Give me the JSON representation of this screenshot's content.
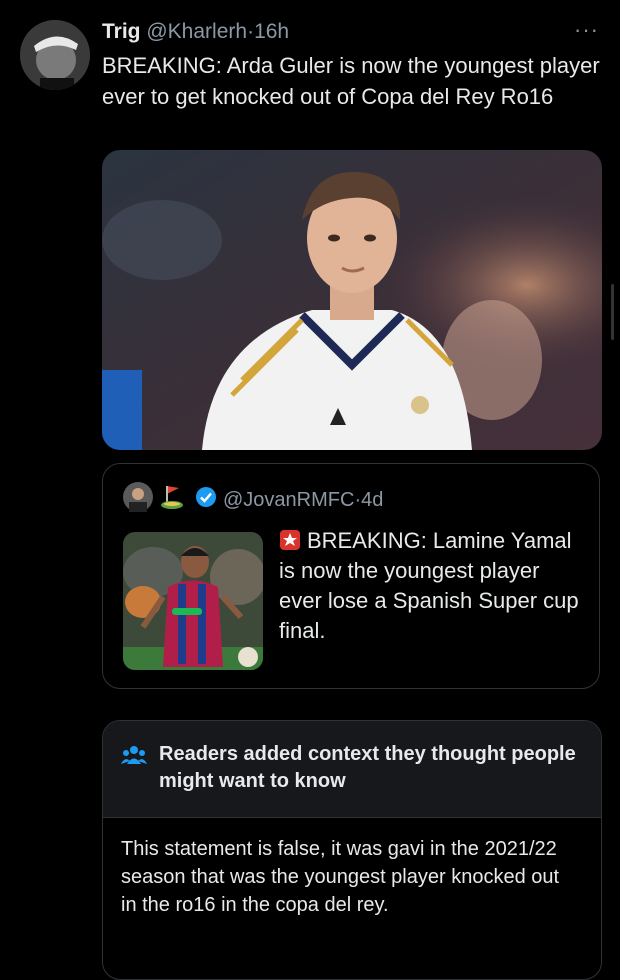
{
  "tweet": {
    "display_name": "Trig",
    "handle": "@Kharlerh",
    "separator": "·",
    "time": "16h",
    "more_label": "···",
    "text": "BREAKING: Arda Guler is now the youngest player ever to get knocked out of Copa del Rey Ro16",
    "media_icon": "photo-of-footballer-in-white-kit"
  },
  "quote": {
    "handle": "@JovanRMFC",
    "separator": "·",
    "time": "4d",
    "text": "BREAKING: Lamine Yamal is now the youngest player ever lose a Spanish Super cup final.",
    "thumb_icon": "photo-of-footballer-in-barcelona-kit"
  },
  "context": {
    "title": "Readers added context they thought people might want to know",
    "body": "This statement is false, it was gavi in the 2021/22 season that was the youngest player knocked out in the ro16 in the copa del rey."
  },
  "colors": {
    "background": "#000000",
    "text": "#e7e9ea",
    "muted": "#8b98a5",
    "border": "#2f3336",
    "verified": "#1d9bf0",
    "context_header_bg": "#16181c",
    "context_icon": "#1d9bf0"
  }
}
